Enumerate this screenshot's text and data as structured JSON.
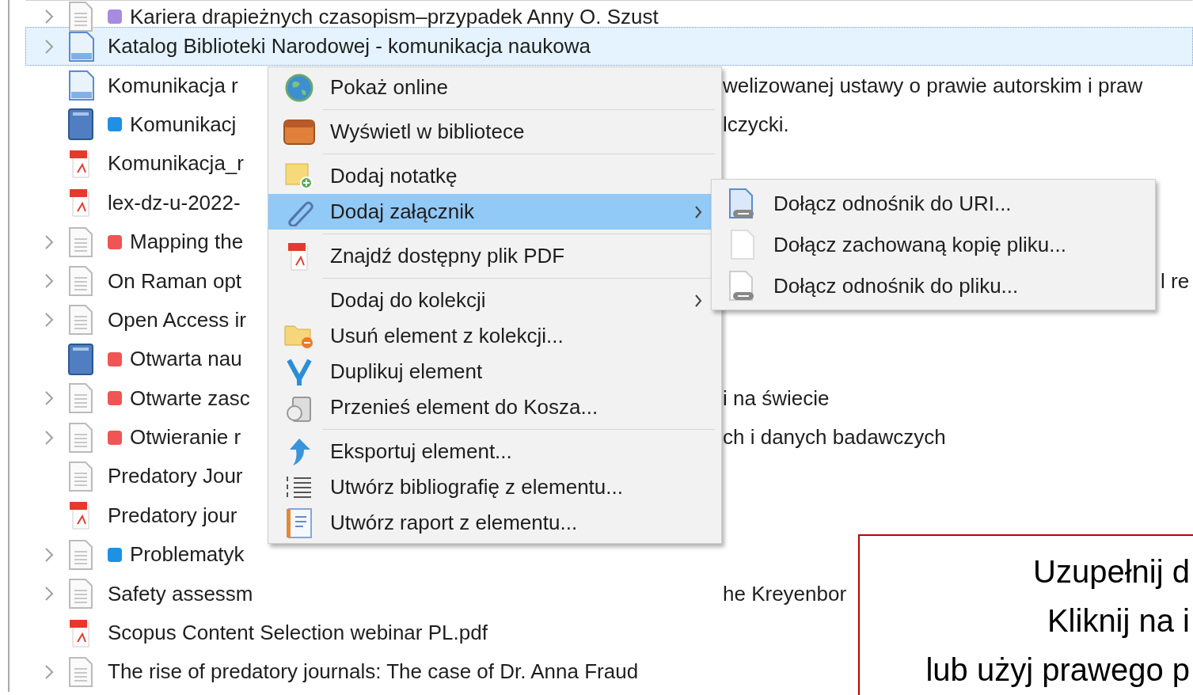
{
  "items": [
    {
      "kind": "document",
      "expandable": true,
      "selected": false,
      "color": "#a78be0",
      "title": "Kariera drapieżnych czasopism–przypadek Anny O. Szust"
    },
    {
      "kind": "webpage",
      "expandable": true,
      "selected": true,
      "title": "Katalog Biblioteki Narodowej - komunikacja naukowa"
    },
    {
      "kind": "webpage",
      "expandable": false,
      "selected": false,
      "title": "Komunikacja r",
      "title_end": "welizowanej ustawy o prawie autorskim i praw"
    },
    {
      "kind": "book",
      "expandable": false,
      "selected": false,
      "color": "#1e90e6",
      "title": "Komunikacj",
      "title_end": "lczycki."
    },
    {
      "kind": "pdf",
      "expandable": false,
      "selected": false,
      "title": "Komunikacja_r"
    },
    {
      "kind": "pdf",
      "expandable": false,
      "selected": false,
      "title": "lex-dz-u-2022-"
    },
    {
      "kind": "document",
      "expandable": true,
      "selected": false,
      "color": "#f05454",
      "title": "Mapping the"
    },
    {
      "kind": "document",
      "expandable": true,
      "selected": false,
      "title": "On Raman opt",
      "title_far_end": "l re"
    },
    {
      "kind": "document",
      "expandable": true,
      "selected": false,
      "title": "Open Access ir"
    },
    {
      "kind": "book",
      "expandable": false,
      "selected": false,
      "color": "#f05454",
      "title": "Otwarta nau"
    },
    {
      "kind": "document",
      "expandable": true,
      "selected": false,
      "color": "#f05454",
      "title": "Otwarte zasc",
      "title_end": "i na świecie"
    },
    {
      "kind": "document",
      "expandable": true,
      "selected": false,
      "color": "#f05454",
      "title": "Otwieranie r",
      "title_end": "ch i danych badawczych"
    },
    {
      "kind": "document",
      "expandable": false,
      "selected": false,
      "title": "Predatory Jour"
    },
    {
      "kind": "pdf",
      "expandable": false,
      "selected": false,
      "title": "Predatory jour"
    },
    {
      "kind": "document",
      "expandable": true,
      "selected": false,
      "color": "#1e90e6",
      "title": "Problematyk"
    },
    {
      "kind": "document",
      "expandable": true,
      "selected": false,
      "title": "Safety assessm",
      "title_end": "he Kreyenbor"
    },
    {
      "kind": "pdf",
      "expandable": false,
      "selected": false,
      "title": "Scopus Content Selection webinar PL.pdf"
    },
    {
      "kind": "document",
      "expandable": true,
      "selected": false,
      "title": "The rise of predatory journals: The case of Dr. Anna Fraud"
    }
  ],
  "context_menu": [
    {
      "kind": "item",
      "label": "Pokaż online",
      "selected": false,
      "submenu": false
    },
    {
      "kind": "separator"
    },
    {
      "kind": "item",
      "label": "Wyświetl w bibliotece",
      "selected": false,
      "submenu": false
    },
    {
      "kind": "separator"
    },
    {
      "kind": "item",
      "label": "Dodaj notatkę",
      "selected": false,
      "submenu": false
    },
    {
      "kind": "item",
      "label": "Dodaj załącznik",
      "selected": true,
      "submenu": true
    },
    {
      "kind": "separator"
    },
    {
      "kind": "item",
      "label": "Znajdź dostępny plik PDF",
      "selected": false,
      "submenu": false
    },
    {
      "kind": "separator"
    },
    {
      "kind": "item",
      "label": "Dodaj do kolekcji",
      "selected": false,
      "submenu": true
    },
    {
      "kind": "item",
      "label": "Usuń element z kolekcji...",
      "selected": false,
      "submenu": false
    },
    {
      "kind": "item",
      "label": "Duplikuj element",
      "selected": false,
      "submenu": false
    },
    {
      "kind": "item",
      "label": "Przenieś element do Kosza...",
      "selected": false,
      "submenu": false
    },
    {
      "kind": "separator"
    },
    {
      "kind": "item",
      "label": "Eksportuj element...",
      "selected": false,
      "submenu": false
    },
    {
      "kind": "item",
      "label": "Utwórz bibliografię z elementu...",
      "selected": false,
      "submenu": false
    },
    {
      "kind": "item",
      "label": "Utwórz raport z elementu...",
      "selected": false,
      "submenu": false
    }
  ],
  "submenu": [
    {
      "kind": "uri-link",
      "label": "Dołącz odnośnik do URI..."
    },
    {
      "kind": "file-copy",
      "label": "Dołącz zachowaną kopię pliku..."
    },
    {
      "kind": "file-link",
      "label": "Dołącz odnośnik do pliku..."
    }
  ],
  "callout": {
    "lines": [
      "Uzupełnij d",
      "Kliknij na i",
      "lub użyj prawego p"
    ]
  }
}
